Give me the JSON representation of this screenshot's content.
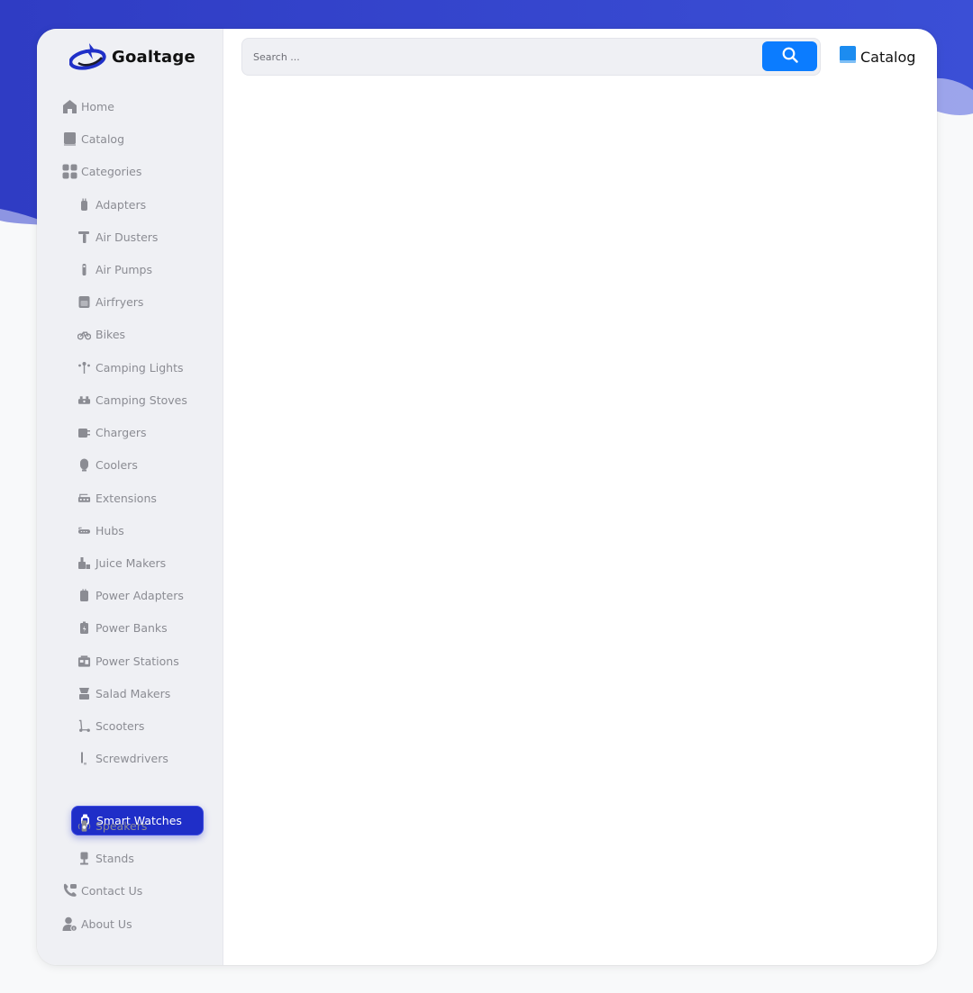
{
  "brand": {
    "name": "Goaltage"
  },
  "search": {
    "placeholder": "Search ..."
  },
  "header": {
    "catalog_label": "Catalog"
  },
  "colors": {
    "accent": "#1f2ec8",
    "search_button": "#0b7cff",
    "banner": "#3240cf",
    "catalog_icon": "#1c8cf0"
  },
  "nav": {
    "home": "Home",
    "catalog": "Catalog",
    "categories": "Categories",
    "contact": "Contact Us",
    "about": "About Us"
  },
  "categories": [
    {
      "label": "Adapters",
      "icon": "adapter-icon"
    },
    {
      "label": "Air Dusters",
      "icon": "air-duster-icon"
    },
    {
      "label": "Air Pumps",
      "icon": "air-pump-icon"
    },
    {
      "label": "Airfryers",
      "icon": "airfryer-icon"
    },
    {
      "label": "Bikes",
      "icon": "bike-icon"
    },
    {
      "label": "Camping Lights",
      "icon": "camping-light-icon"
    },
    {
      "label": "Camping Stoves",
      "icon": "camping-stove-icon"
    },
    {
      "label": "Chargers",
      "icon": "charger-icon"
    },
    {
      "label": "Coolers",
      "icon": "cooler-icon"
    },
    {
      "label": "Extensions",
      "icon": "extension-icon"
    },
    {
      "label": "Hubs",
      "icon": "hub-icon"
    },
    {
      "label": "Juice Makers",
      "icon": "juice-maker-icon"
    },
    {
      "label": "Power Adapters",
      "icon": "power-adapter-icon"
    },
    {
      "label": "Power Banks",
      "icon": "power-bank-icon"
    },
    {
      "label": "Power Stations",
      "icon": "power-station-icon"
    },
    {
      "label": "Salad Makers",
      "icon": "salad-maker-icon"
    },
    {
      "label": "Scooters",
      "icon": "scooter-icon"
    },
    {
      "label": "Screwdrivers",
      "icon": "screwdriver-icon"
    },
    {
      "label": "Smart Watches",
      "icon": "smart-watch-icon",
      "active": true
    },
    {
      "label": "Speakers",
      "icon": "speaker-icon"
    },
    {
      "label": "Stands",
      "icon": "stand-icon"
    }
  ]
}
